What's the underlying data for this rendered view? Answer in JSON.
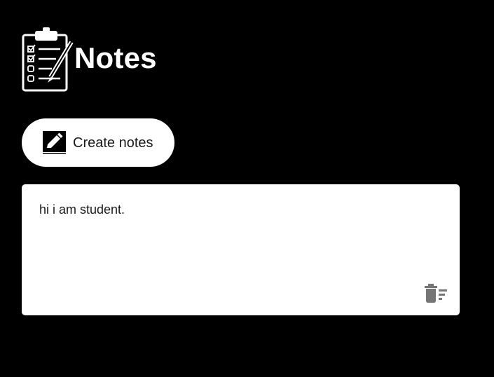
{
  "header": {
    "title": "Notes",
    "logo_icon": "clipboard-checklist-icon"
  },
  "toolbar": {
    "create_label": "Create notes",
    "create_icon": "edit-pencil-icon"
  },
  "notes": [
    {
      "text": "hi i am student.",
      "delete_icon": "delete-sweep-icon"
    }
  ],
  "colors": {
    "background": "#000000",
    "card": "#ffffff",
    "text": "#1a1a1a",
    "icon_gray": "#757575"
  }
}
